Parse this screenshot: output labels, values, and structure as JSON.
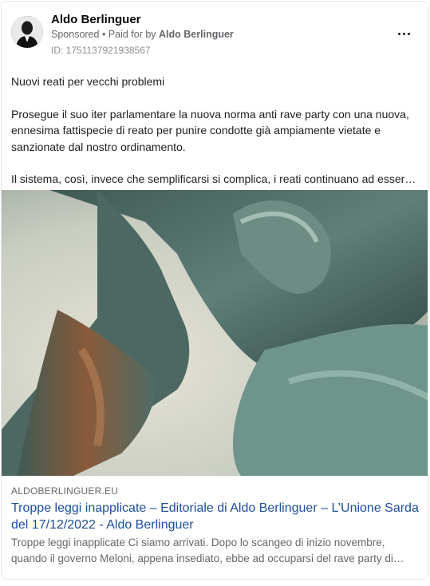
{
  "post": {
    "page_name": "Aldo Berlinguer",
    "sponsored_label": "Sponsored",
    "separator": " • ",
    "paid_for_prefix": "Paid for by ",
    "paid_for_name": "Aldo Berlinguer",
    "ad_id": "ID: 1751137921938567",
    "menu_icon": "more-horizontal-icon"
  },
  "body": {
    "headline": "Nuovi reati per vecchi problemi",
    "paragraph_1": "Prosegue il suo iter parlamentare la nuova norma anti rave party con una nuova, ennesima fattispecie di reato per punire condotte già ampiamente vietate e sanzionate dal nostro ordinamento.",
    "paragraph_2": "Il sistema, così, invece che semplificarsi si complica, i reati continuano ad essere…"
  },
  "link_preview": {
    "domain": "ALDOBERLINGUER.EU",
    "title": "Troppe leggi inapplicate – Editoriale di Aldo Berlinguer – L’Unione Sarda del 17/12/2022 - Aldo Berlinguer",
    "description": "Troppe leggi inapplicate Ci siamo arrivati. Dopo lo scangeo di inizio novembre, quando il governo Meloni, appena insediato, ebbe ad occuparsi del rave party di…"
  },
  "colors": {
    "link_title": "#1d4f9c",
    "secondary_text": "#65676b",
    "border": "#e4e6eb"
  }
}
